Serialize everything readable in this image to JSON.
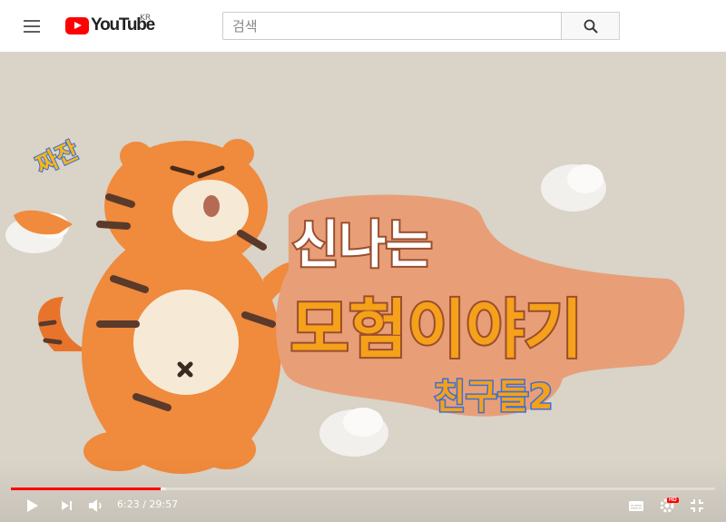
{
  "header": {
    "logo_text": "YouTube",
    "country_code": "KR",
    "search_placeholder": "검색"
  },
  "video": {
    "title_line1": "신나는",
    "title_line2": "모험이야기",
    "title_line3": "친구들2",
    "exclaim": "짜잔",
    "progress": {
      "played_fraction": 0.2122,
      "loaded_fraction": 0.22
    }
  },
  "player_controls": {
    "time_display": "6:23 / 29:57",
    "quality_badge": "HD"
  },
  "colors": {
    "brand_red": "#ff0000",
    "title_orange": "#f5a11a",
    "title_white": "#ffffff",
    "title_blue": "#3c6fd8",
    "outline_brown": "#9b4e2d"
  }
}
